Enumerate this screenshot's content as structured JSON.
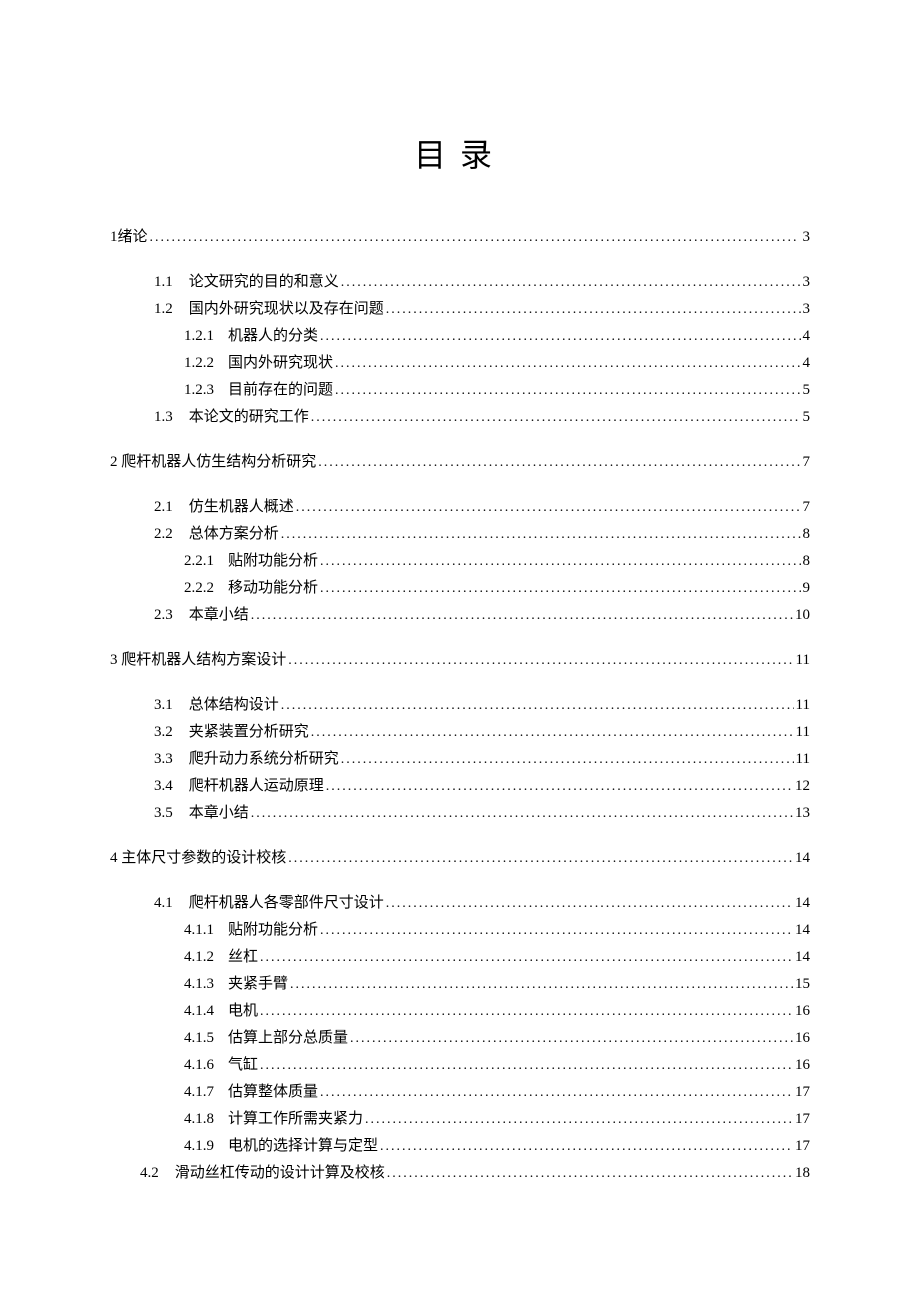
{
  "title": "目录",
  "toc": [
    {
      "level": 1,
      "num": "1",
      "text": "绪论",
      "page": "3",
      "nospace": true
    },
    {
      "level": 2,
      "num": "1.1",
      "text": "论文研究的目的和意义",
      "page": "3"
    },
    {
      "level": 2,
      "num": "1.2",
      "text": "国内外研究现状以及存在问题",
      "page": "3"
    },
    {
      "level": 3,
      "num": "1.2.1",
      "text": "机器人的分类",
      "page": "4"
    },
    {
      "level": 3,
      "num": "1.2.2",
      "text": "国内外研究现状",
      "page": "4"
    },
    {
      "level": 3,
      "num": "1.2.3",
      "text": "目前存在的问题",
      "page": "5"
    },
    {
      "level": 2,
      "num": "1.3",
      "text": "本论文的研究工作",
      "page": "5"
    },
    {
      "level": 1,
      "num": "2",
      "text": "爬杆机器人仿生结构分析研究",
      "page": "7"
    },
    {
      "level": 2,
      "num": "2.1",
      "text": "仿生机器人概述",
      "page": "7"
    },
    {
      "level": 2,
      "num": "2.2",
      "text": "总体方案分析",
      "page": "8"
    },
    {
      "level": 3,
      "num": "2.2.1",
      "text": "贴附功能分析",
      "page": "8"
    },
    {
      "level": 3,
      "num": "2.2.2",
      "text": "移动功能分析",
      "page": "9"
    },
    {
      "level": 2,
      "num": "2.3",
      "text": "本章小结",
      "page": "10"
    },
    {
      "level": 1,
      "num": "3",
      "text": "爬杆机器人结构方案设计",
      "page": "11"
    },
    {
      "level": 2,
      "num": "3.1",
      "text": "总体结构设计",
      "page": "11"
    },
    {
      "level": 2,
      "num": "3.2",
      "text": "夹紧装置分析研究",
      "page": "11"
    },
    {
      "level": 2,
      "num": "3.3",
      "text": "爬升动力系统分析研究",
      "page": "11"
    },
    {
      "level": 2,
      "num": "3.4",
      "text": "爬杆机器人运动原理",
      "page": "12"
    },
    {
      "level": 2,
      "num": "3.5",
      "text": "本章小结",
      "page": "13"
    },
    {
      "level": 1,
      "num": "4",
      "text": "主体尺寸参数的设计校核",
      "page": "14"
    },
    {
      "level": 2,
      "num": "4.1",
      "text": "爬杆机器人各零部件尺寸设计",
      "page": "14"
    },
    {
      "level": 3,
      "num": "4.1.1",
      "text": "贴附功能分析",
      "page": "14"
    },
    {
      "level": 3,
      "num": "4.1.2",
      "text": "丝杠",
      "page": "14"
    },
    {
      "level": 3,
      "num": "4.1.3",
      "text": "夹紧手臂",
      "page": "15"
    },
    {
      "level": 3,
      "num": "4.1.4",
      "text": "电机",
      "page": "16"
    },
    {
      "level": 3,
      "num": "4.1.5",
      "text": "估算上部分总质量",
      "page": "16"
    },
    {
      "level": 3,
      "num": "4.1.6",
      "text": "气缸",
      "page": "16"
    },
    {
      "level": 3,
      "num": "4.1.7",
      "text": "估算整体质量",
      "page": "17"
    },
    {
      "level": 3,
      "num": "4.1.8",
      "text": "计算工作所需夹紧力",
      "page": "17"
    },
    {
      "level": 3,
      "num": "4.1.9",
      "text": "电机的选择计算与定型",
      "page": "17"
    },
    {
      "level": 2,
      "num": "4.2",
      "text": "滑动丝杠传动的设计计算及校核",
      "page": "18",
      "special": "42"
    }
  ]
}
